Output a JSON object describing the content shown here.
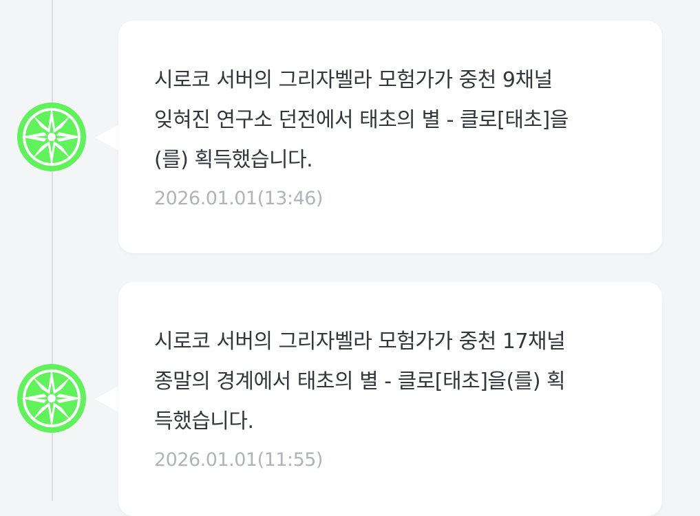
{
  "feed": {
    "icon": "green-star-compass-icon",
    "accent_color": "#5ff25a",
    "items": [
      {
        "lines": [
          "시로코 서버의 그리자벨라 모험가가 중천 9채널",
          "잊혀진 연구소 던전에서 태초의 별 - 클로[태초]을",
          "(를) 획득했습니다."
        ],
        "timestamp": "2026.01.01(13:46)"
      },
      {
        "lines": [
          "시로코 서버의 그리자벨라 모험가가 중천 17채널",
          "종말의 경계에서 태초의 별 - 클로[태초]을(를) 획",
          "득했습니다."
        ],
        "timestamp": "2026.01.01(11:55)"
      }
    ]
  }
}
